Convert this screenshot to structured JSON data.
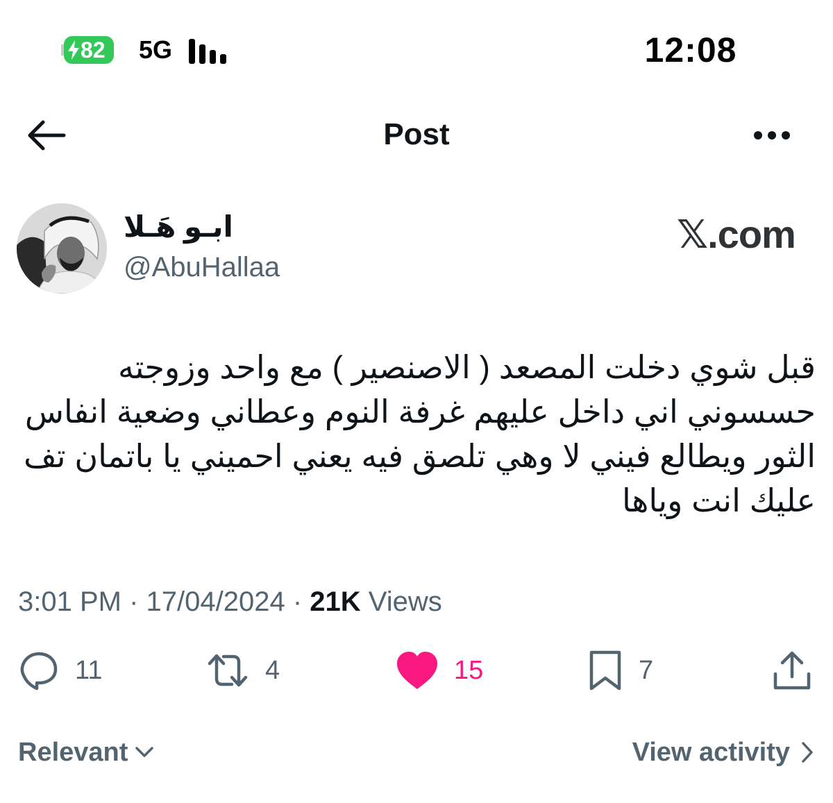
{
  "status_bar": {
    "battery_level": "82",
    "network": "5G",
    "time": "12:08",
    "colors": {
      "battery": "#34c759"
    }
  },
  "header": {
    "title": "Post",
    "back_icon": "arrow-left-icon",
    "more_icon": "more-horizontal-icon"
  },
  "author": {
    "display_name": "ابـو هَـلا",
    "handle": "@AbuHallaa"
  },
  "watermark": "𝕏.com",
  "tweet": {
    "text": "قبل شوي دخلت المصعد ( الاصنصير ) مع واحد وزوجته حسسوني اني داخل عليهم غرفة النوم وعطاني وضعية انفاس الثور ويطالع فيني لا وهي تلصق فيه يعني احميني يا باتمان تف عليك انت وياها"
  },
  "meta": {
    "time": "3:01 PM",
    "separator_1": " · ",
    "date": "17/04/2024",
    "separator_2": " · ",
    "views_count": "21K",
    "views_label": " Views"
  },
  "actions": {
    "replies": "11",
    "reposts": "4",
    "likes": "15",
    "bookmarks": "7",
    "icons": [
      "reply-icon",
      "repost-icon",
      "like-icon",
      "bookmark-icon",
      "share-icon"
    ],
    "colors": {
      "liked": "#f91880",
      "muted": "#536471"
    }
  },
  "footer": {
    "sort_label": "Relevant",
    "view_activity_label": "View activity"
  }
}
